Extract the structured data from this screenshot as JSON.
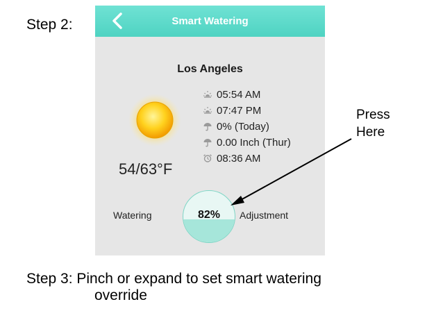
{
  "step2": {
    "label": "Step 2:"
  },
  "app": {
    "title": "Smart Watering",
    "back_icon": "chevron-left-icon",
    "accent_color": "#4fd3c2"
  },
  "weather": {
    "city": "Los Angeles",
    "condition_icon": "sun-icon",
    "temperature": "54/63°F",
    "details": [
      {
        "icon": "sunrise-icon",
        "text": "05:54 AM"
      },
      {
        "icon": "sunset-icon",
        "text": "07:47 PM"
      },
      {
        "icon": "rain-chance-icon",
        "text": "0% (Today)"
      },
      {
        "icon": "rainfall-icon",
        "text": "0.00 Inch (Thur)"
      },
      {
        "icon": "alarm-icon",
        "text": "08:36 AM"
      }
    ]
  },
  "adjustment": {
    "left_label": "Watering",
    "right_label": "Adjustment",
    "value_text": "82%",
    "level": 0.82
  },
  "callout": {
    "line1": "Press",
    "line2": "Here"
  },
  "step3": {
    "line1": "Step 3: Pinch or expand to set smart watering",
    "line2": "override"
  }
}
